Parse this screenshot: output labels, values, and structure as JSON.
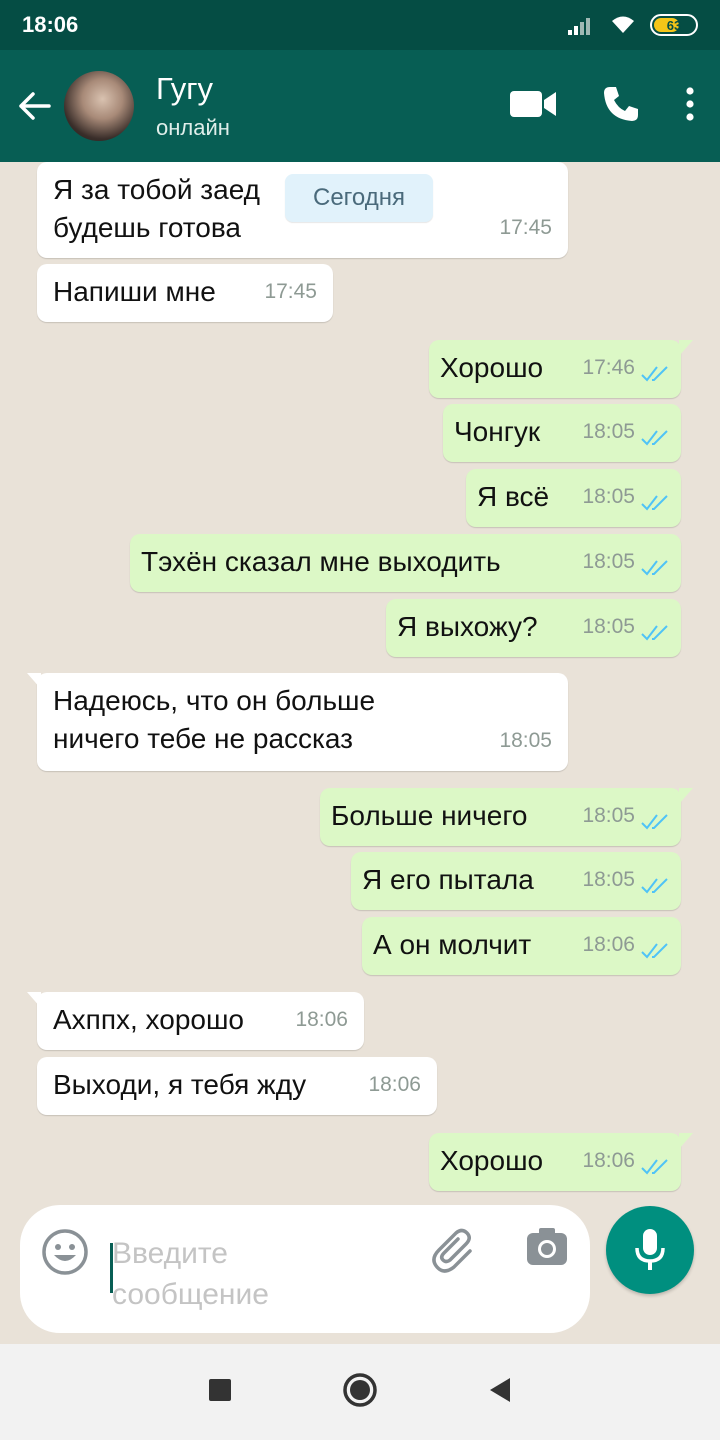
{
  "status_bar": {
    "time": "18:06",
    "battery": "63"
  },
  "header": {
    "contact_name": "Гугу",
    "contact_status": "онлайн"
  },
  "date_divider": "Сегодня",
  "messages": [
    {
      "dir": "in",
      "lines": [
        "Я за тобой заед",
        "будешь готова"
      ],
      "time": "17:45"
    },
    {
      "dir": "in",
      "lines": [
        "Напиши мне"
      ],
      "time": "17:45"
    },
    {
      "dir": "out",
      "lines": [
        "Хорошо"
      ],
      "time": "17:46",
      "read": true
    },
    {
      "dir": "out",
      "lines": [
        "Чонгук"
      ],
      "time": "18:05",
      "read": true
    },
    {
      "dir": "out",
      "lines": [
        "Я всё"
      ],
      "time": "18:05",
      "read": true
    },
    {
      "dir": "out",
      "lines": [
        "Тэхён сказал мне выходить"
      ],
      "time": "18:05",
      "read": true
    },
    {
      "dir": "out",
      "lines": [
        "Я выхожу?"
      ],
      "time": "18:05",
      "read": true
    },
    {
      "dir": "in",
      "lines": [
        "Надеюсь, что он больше",
        "ничего тебе не рассказ"
      ],
      "time": "18:05"
    },
    {
      "dir": "out",
      "lines": [
        "Больше ничего"
      ],
      "time": "18:05",
      "read": true
    },
    {
      "dir": "out",
      "lines": [
        "Я его пытала"
      ],
      "time": "18:05",
      "read": true
    },
    {
      "dir": "out",
      "lines": [
        "А он молчит"
      ],
      "time": "18:06",
      "read": true
    },
    {
      "dir": "in",
      "lines": [
        "Ахппх, хорошо"
      ],
      "time": "18:06"
    },
    {
      "dir": "in",
      "lines": [
        "Выходи, я тебя жду"
      ],
      "time": "18:06"
    },
    {
      "dir": "out",
      "lines": [
        "Хорошо"
      ],
      "time": "18:06",
      "read": true
    }
  ],
  "composer": {
    "placeholder": "Введите сообщение"
  },
  "icons": {
    "back": "arrow-left-icon",
    "video": "video-call-icon",
    "call": "phone-icon",
    "menu": "more-vert-icon",
    "emoji": "emoji-icon",
    "attach": "paperclip-icon",
    "camera": "camera-icon",
    "mic": "mic-icon",
    "ticks": "double-check-icon"
  },
  "colors": {
    "header": "#075e54",
    "status_bar": "#054d44",
    "outgoing": "#dcf8c6",
    "incoming": "#ffffff",
    "ticks": "#4fc3f7",
    "mic": "#008f7f"
  }
}
